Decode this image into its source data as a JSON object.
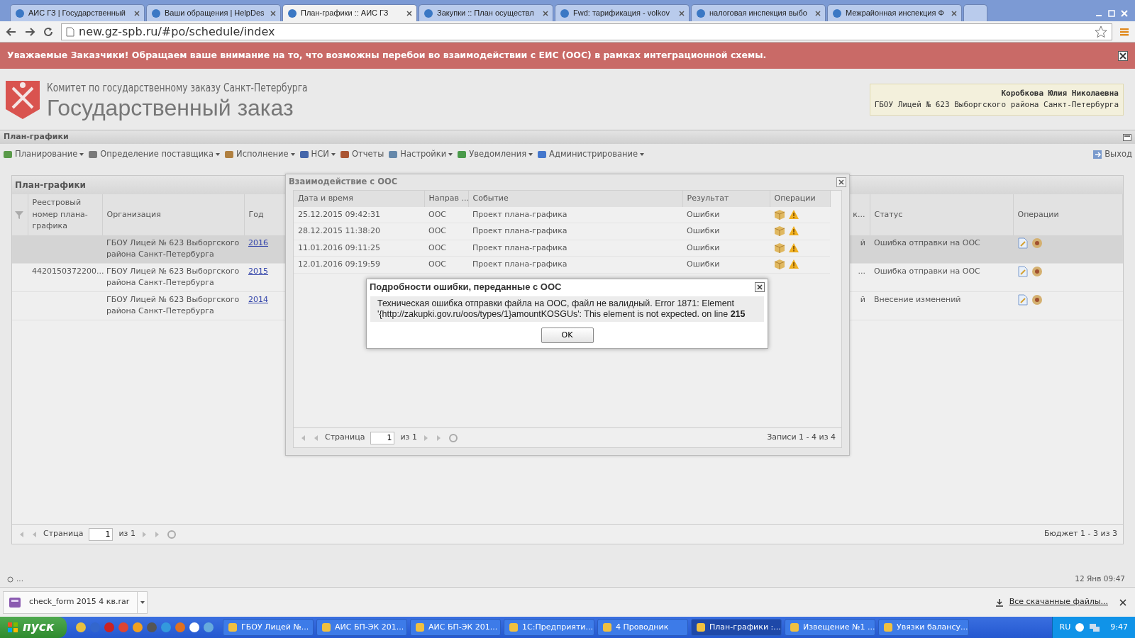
{
  "browser": {
    "tabs": [
      {
        "label": "АИС ГЗ | Государственный",
        "selected": false
      },
      {
        "label": "Ваши обращения | HelpDes",
        "selected": false
      },
      {
        "label": "План-графики :: АИС ГЗ",
        "selected": true
      },
      {
        "label": "Закупки :: План осуществл",
        "selected": false
      },
      {
        "label": "Fwd: тарификация - volkov",
        "selected": false
      },
      {
        "label": "налоговая инспекция выбо",
        "selected": false
      },
      {
        "label": "Межрайонная инспекция Ф",
        "selected": false
      }
    ],
    "address": "new.gz-spb.ru/#po/schedule/index"
  },
  "alert": {
    "text": "Уважаемые Заказчики! Обращаем ваше внимание на то, что возможны перебои во взаимодействии с ЕИС (ООС) в рамках интеграционной схемы."
  },
  "header": {
    "org_line": "Комитет по государственному заказу Санкт-Петербурга",
    "title": "Государственный заказ",
    "user_name": "Коробкова Юлия Николаевна",
    "user_org": "ГБОУ Лицей № 623 Выборгского района Санкт-Петербурга"
  },
  "panel_title": "План-графики",
  "menu": [
    {
      "label": "Планирование",
      "dropdown": true
    },
    {
      "label": "Определение поставщика",
      "dropdown": true
    },
    {
      "label": "Исполнение",
      "dropdown": true
    },
    {
      "label": "НСИ",
      "dropdown": true
    },
    {
      "label": "Отчеты",
      "dropdown": false
    },
    {
      "label": "Настройки",
      "dropdown": true
    },
    {
      "label": "Уведомления",
      "dropdown": true
    },
    {
      "label": "Администрирование",
      "dropdown": true
    }
  ],
  "exit": "Выход",
  "grid": {
    "title": "План-графики",
    "columns": [
      "Реестровый номер плана-графика",
      "Организация",
      "Год",
      "к...",
      "Статус",
      "Операции"
    ],
    "rows": [
      {
        "reg": "",
        "org": "ГБОУ Лицей № 623 Выборгского района Санкт-Петербурга",
        "year": "2016",
        "column_4": "й",
        "status": "Ошибка отправки на ООС",
        "selected": true
      },
      {
        "reg": "4420150372200...",
        "org": "ГБОУ Лицей № 623 Выборгского района Санкт-Петербурга",
        "year": "2015",
        "column_4": "...",
        "status": "Ошибка отправки на ООС",
        "selected": false
      },
      {
        "reg": "",
        "org": "ГБОУ Лицей № 623 Выборгского района Санкт-Петербурга",
        "year": "2014",
        "column_4": "й",
        "status": "Внесение изменений",
        "selected": false
      }
    ],
    "pager": {
      "page_label": "Страница",
      "page": "1",
      "of": "из 1",
      "summary": "Бюджет 1 - 3 из 3"
    }
  },
  "ooc_dialog": {
    "title": "Взаимодействие с ООС",
    "columns": [
      "Дата и время",
      "Направ ...",
      "Событие",
      "Результат",
      "Операции"
    ],
    "rows": [
      {
        "date": "25.12.2015 09:42:31",
        "direction": "ООС",
        "event": "Проект плана-графика",
        "result": "Ошибки"
      },
      {
        "date": "28.12.2015 11:38:20",
        "direction": "ООС",
        "event": "Проект плана-графика",
        "result": "Ошибки"
      },
      {
        "date": "11.01.2016 09:11:25",
        "direction": "ООС",
        "event": "Проект плана-графика",
        "result": "Ошибки"
      },
      {
        "date": "12.01.2016 09:19:59",
        "direction": "ООС",
        "event": "Проект плана-графика",
        "result": "Ошибки"
      }
    ],
    "pager": {
      "page_label": "Страница",
      "page": "1",
      "of": "из 1",
      "summary": "Записи 1 - 4 из 4"
    }
  },
  "error_dialog": {
    "title": "Подробности ошибки, переданные с ООС",
    "message": "Техническая ошибка отправки файла на ООС, файл не валидный. Error 1871: Element '{http://zakupki.gov.ru/oos/types/1}amountKOSGUs': This element is not expected. on line **215**",
    "button": "OK"
  },
  "status_bar": {
    "left": "...",
    "right": "12 Янв 09:47"
  },
  "downloads": {
    "file": "check_form 2015 4 кв.rar",
    "all_link": "Все скачанные файлы..."
  },
  "taskbar": {
    "start": "пуск",
    "tasks": [
      {
        "label": "ГБОУ Лицей №...",
        "selected": false
      },
      {
        "label": "АИС БП-ЭК 201...",
        "selected": false
      },
      {
        "label": "АИС БП-ЭК 201...",
        "selected": false
      },
      {
        "label": "1С:Предприяти...",
        "selected": false
      },
      {
        "label": "4 Проводник",
        "selected": false
      },
      {
        "label": "План-графики :...",
        "selected": true
      },
      {
        "label": "Извещение №1 ...",
        "selected": false
      },
      {
        "label": "Увязки балансу...",
        "selected": false
      }
    ],
    "lang": "RU",
    "time": "9:47"
  }
}
